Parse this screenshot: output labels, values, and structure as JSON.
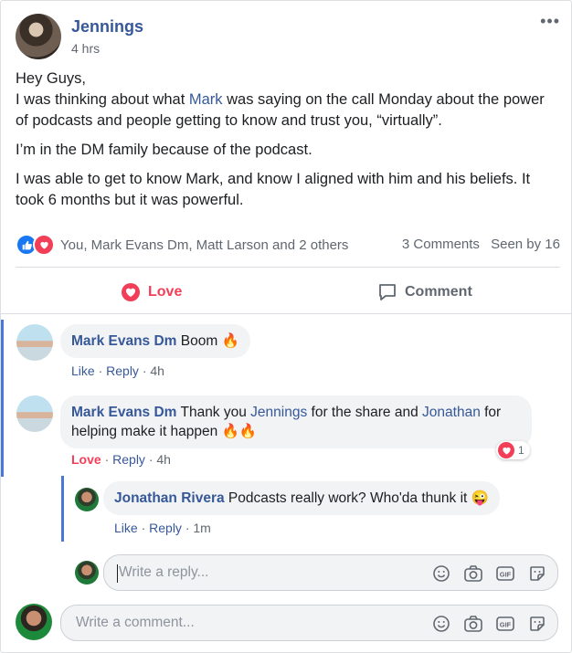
{
  "post": {
    "author": "Jennings",
    "time": "4 hrs",
    "more": "•••",
    "greeting": "Hey Guys,",
    "p1_before": "I was thinking about what ",
    "p1_link": "Mark",
    "p1_after": " was saying on the call Monday about the power of podcasts and people getting to know and trust you, “virtually”.",
    "p2": "I’m in the DM family because of the podcast.",
    "p3": "I was able to get to know Mark, and know I aligned with him and his beliefs. It took 6 months but it was powerful."
  },
  "reactions": {
    "summary": "You, Mark Evans Dm, Matt Larson and 2 others",
    "comments_count": "3 Comments",
    "seen_by": "Seen by 16"
  },
  "actions": {
    "love": "Love",
    "comment": "Comment"
  },
  "comments": [
    {
      "author": "Mark Evans Dm",
      "text": " Boom ",
      "emoji": "🔥",
      "like": "Like",
      "reply": "Reply",
      "time": "4h"
    },
    {
      "author": "Mark Evans Dm",
      "text_a": " Thank you ",
      "link_a": "Jennings",
      "text_b": " for the share and ",
      "link_b": "Jonathan",
      "text_c": " for helping make it happen ",
      "emoji": "🔥🔥",
      "love": "Love",
      "reply": "Reply",
      "time": "4h",
      "reaction_count": "1"
    }
  ],
  "reply": {
    "author": "Jonathan Rivera",
    "text": " Podcasts really work? Who'da thunk it ",
    "emoji": "😜",
    "like": "Like",
    "reply": "Reply",
    "time": "1m"
  },
  "reply_input": {
    "placeholder": "Write a reply..."
  },
  "comment_input": {
    "placeholder": "Write a comment..."
  },
  "icons": [
    "emoji-icon",
    "camera-icon",
    "gif-icon",
    "sticker-icon"
  ],
  "colors": {
    "link": "#365899",
    "love": "#f33e58",
    "like": "#1877f2",
    "thread_bar": "#4a76d6"
  }
}
